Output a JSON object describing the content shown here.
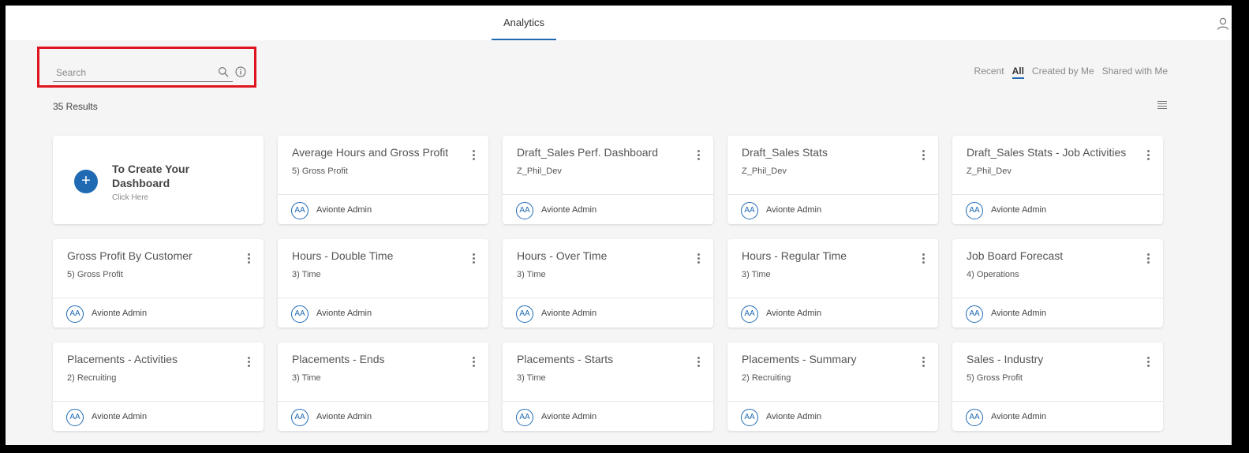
{
  "header": {
    "active_tab": "Analytics"
  },
  "search": {
    "placeholder": "Search",
    "value": ""
  },
  "filters": [
    "Recent",
    "All",
    "Created by Me",
    "Shared with Me"
  ],
  "active_filter": "All",
  "results_label": "35 Results",
  "create_card": {
    "title": "To Create Your Dashboard",
    "subtitle": "Click Here"
  },
  "cards": [
    {
      "title": "Average Hours and Gross Profit",
      "category": "5) Gross Profit",
      "owner_initials": "AA",
      "owner": "Avionte Admin"
    },
    {
      "title": "Draft_Sales Perf. Dashboard",
      "category": "Z_Phil_Dev",
      "owner_initials": "AA",
      "owner": "Avionte Admin"
    },
    {
      "title": "Draft_Sales Stats",
      "category": "Z_Phil_Dev",
      "owner_initials": "AA",
      "owner": "Avionte Admin"
    },
    {
      "title": "Draft_Sales Stats - Job Activities",
      "category": "Z_Phil_Dev",
      "owner_initials": "AA",
      "owner": "Avionte Admin"
    },
    {
      "title": "Gross Profit By Customer",
      "category": "5) Gross Profit",
      "owner_initials": "AA",
      "owner": "Avionte Admin"
    },
    {
      "title": "Hours - Double Time",
      "category": "3) Time",
      "owner_initials": "AA",
      "owner": "Avionte Admin"
    },
    {
      "title": "Hours - Over Time",
      "category": "3) Time",
      "owner_initials": "AA",
      "owner": "Avionte Admin"
    },
    {
      "title": "Hours - Regular Time",
      "category": "3) Time",
      "owner_initials": "AA",
      "owner": "Avionte Admin"
    },
    {
      "title": "Job Board Forecast",
      "category": "4) Operations",
      "owner_initials": "AA",
      "owner": "Avionte Admin"
    },
    {
      "title": "Placements - Activities",
      "category": "2) Recruiting",
      "owner_initials": "AA",
      "owner": "Avionte Admin"
    },
    {
      "title": "Placements - Ends",
      "category": "3) Time",
      "owner_initials": "AA",
      "owner": "Avionte Admin"
    },
    {
      "title": "Placements - Starts",
      "category": "3) Time",
      "owner_initials": "AA",
      "owner": "Avionte Admin"
    },
    {
      "title": "Placements - Summary",
      "category": "2) Recruiting",
      "owner_initials": "AA",
      "owner": "Avionte Admin"
    },
    {
      "title": "Sales - Industry",
      "category": "5) Gross Profit",
      "owner_initials": "AA",
      "owner": "Avionte Admin"
    }
  ],
  "colors": {
    "accent": "#1f6ab3",
    "highlight": "#e0141e",
    "background": "#f5f5f6"
  },
  "icons": {
    "search": "search-icon",
    "info": "info-icon",
    "user": "user-icon",
    "list_view": "list-view-icon",
    "more": "kebab-menu-icon",
    "add": "plus-icon"
  }
}
